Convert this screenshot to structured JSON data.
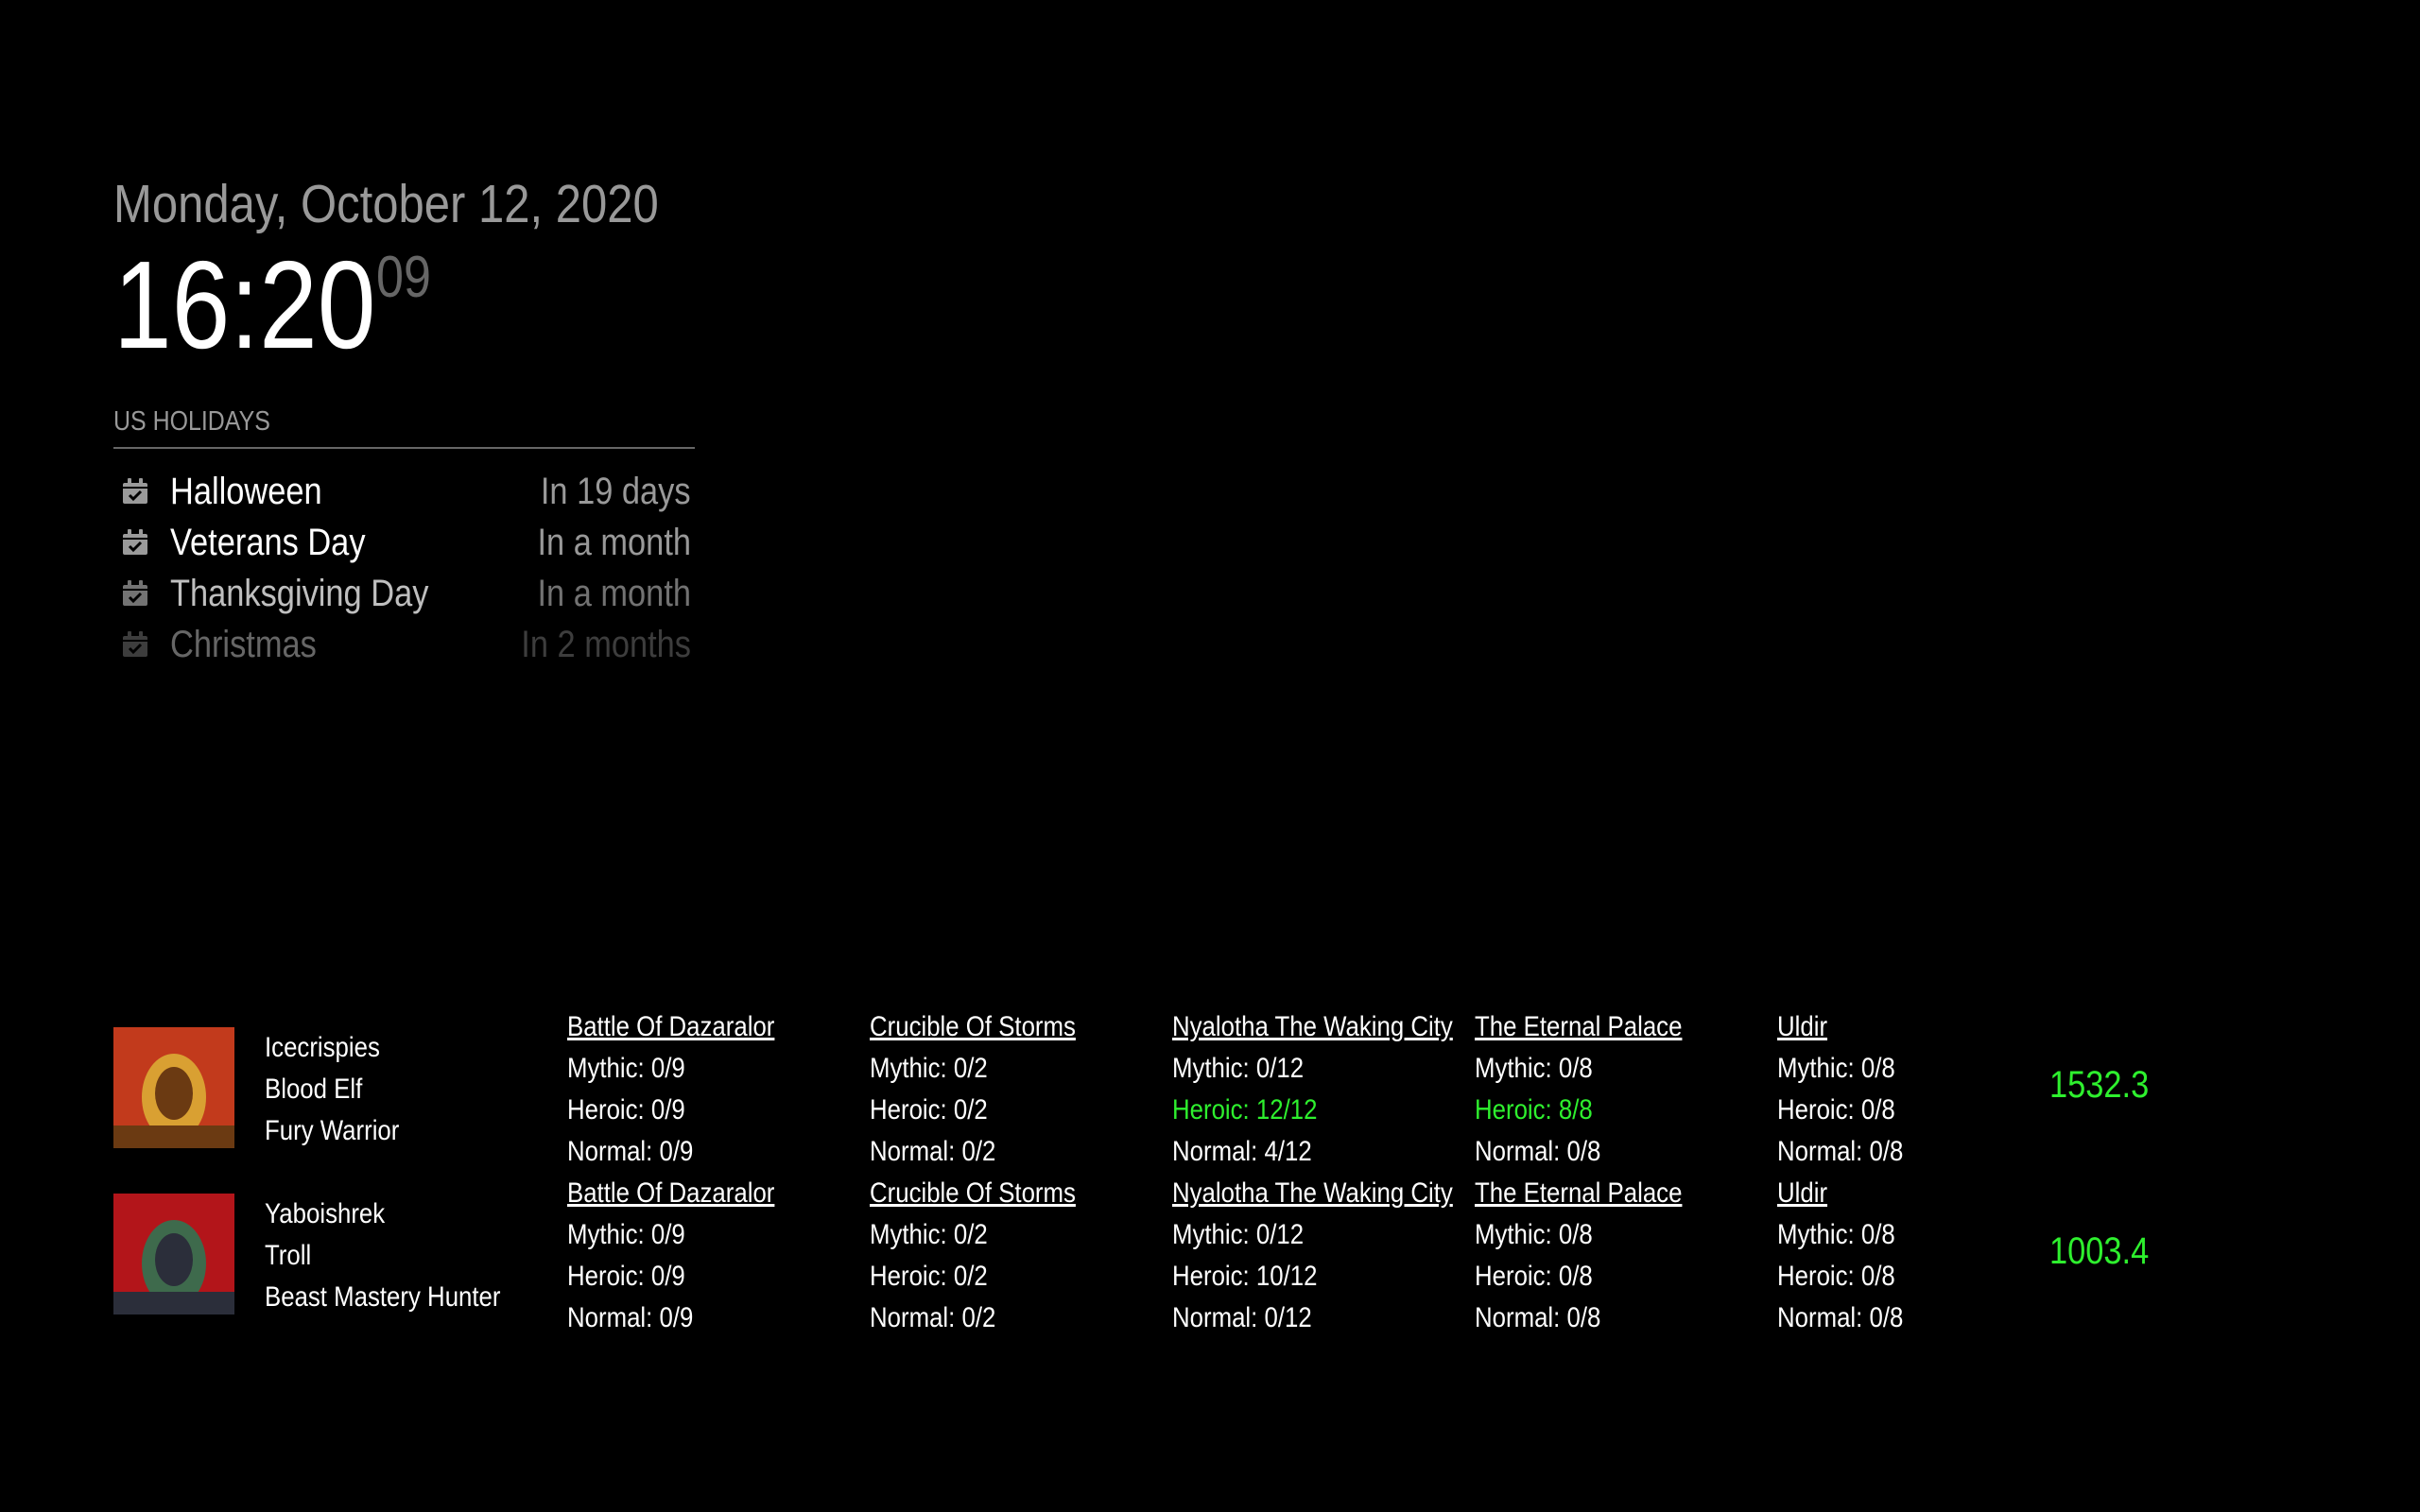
{
  "clock": {
    "date": "Monday, October 12, 2020",
    "time": "16:20",
    "seconds": "09"
  },
  "holidays": {
    "header": "US HOLIDAYS",
    "events": [
      {
        "title": "Halloween",
        "when": "In 19 days",
        "opacity": 1.0,
        "icon": "calendar-check-icon"
      },
      {
        "title": "Veterans Day",
        "when": "In a month",
        "opacity": 1.0,
        "icon": "calendar-check-icon"
      },
      {
        "title": "Thanksgiving Day",
        "when": "In a month",
        "opacity": 0.75,
        "icon": "calendar-check-icon"
      },
      {
        "title": "Christmas",
        "when": "In 2 months",
        "opacity": 0.4,
        "icon": "calendar-check-icon"
      }
    ]
  },
  "characters": [
    {
      "name": "Icecrispies",
      "race": "Blood Elf",
      "spec": "Fury Warrior",
      "score": "1532.3",
      "raids": [
        {
          "name": "Battle Of Dazaralor",
          "mythic": "Mythic: 0/9",
          "heroic": "Heroic: 0/9",
          "normal": "Normal: 0/9",
          "heroic_complete": false
        },
        {
          "name": "Crucible Of Storms",
          "mythic": "Mythic: 0/2",
          "heroic": "Heroic: 0/2",
          "normal": "Normal: 0/2",
          "heroic_complete": false
        },
        {
          "name": "Nyalotha The Waking City",
          "mythic": "Mythic: 0/12",
          "heroic": "Heroic: 12/12",
          "normal": "Normal: 4/12",
          "heroic_complete": true
        },
        {
          "name": "The Eternal Palace",
          "mythic": "Mythic: 0/8",
          "heroic": "Heroic: 8/8",
          "normal": "Normal: 0/8",
          "heroic_complete": true
        },
        {
          "name": "Uldir",
          "mythic": "Mythic: 0/8",
          "heroic": "Heroic: 0/8",
          "normal": "Normal: 0/8",
          "heroic_complete": false
        }
      ]
    },
    {
      "name": "Yaboishrek",
      "race": "Troll",
      "spec": "Beast Mastery Hunter",
      "score": "1003.4",
      "raids": [
        {
          "name": "Battle Of Dazaralor",
          "mythic": "Mythic: 0/9",
          "heroic": "Heroic: 0/9",
          "normal": "Normal: 0/9",
          "heroic_complete": false
        },
        {
          "name": "Crucible Of Storms",
          "mythic": "Mythic: 0/2",
          "heroic": "Heroic: 0/2",
          "normal": "Normal: 0/2",
          "heroic_complete": false
        },
        {
          "name": "Nyalotha The Waking City",
          "mythic": "Mythic: 0/12",
          "heroic": "Heroic: 10/12",
          "normal": "Normal: 0/12",
          "heroic_complete": false
        },
        {
          "name": "The Eternal Palace",
          "mythic": "Mythic: 0/8",
          "heroic": "Heroic: 0/8",
          "normal": "Normal: 0/8",
          "heroic_complete": false
        },
        {
          "name": "Uldir",
          "mythic": "Mythic: 0/8",
          "heroic": "Heroic: 0/8",
          "normal": "Normal: 0/8",
          "heroic_complete": false
        }
      ]
    }
  ],
  "colors": {
    "accent_green": "#2ef02e",
    "text_dim": "#999999",
    "background": "#000000"
  }
}
